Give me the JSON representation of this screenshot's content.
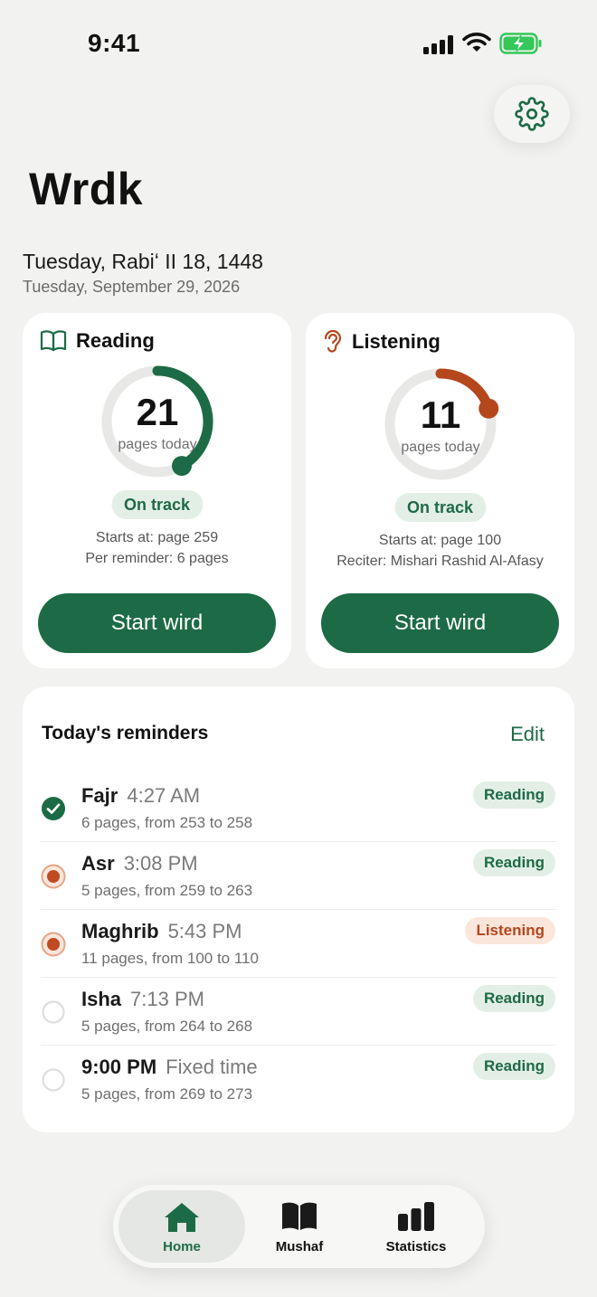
{
  "status_bar": {
    "time": "9:41"
  },
  "app": {
    "title": "Wrdk"
  },
  "dates": {
    "hijri": "Tuesday, Rabiʻ II 18, 1448",
    "gregorian": "Tuesday, September 29, 2026"
  },
  "colors": {
    "primary": "#1d6b46",
    "accent_listening": "#b4471c",
    "background": "#f2f2f0"
  },
  "reading_card": {
    "title": "Reading",
    "icon": "book-icon",
    "count": "21",
    "count_label": "pages today",
    "progress_fraction": 0.42,
    "status": "On track",
    "info_line1": "Starts at: page 259",
    "info_line2": "Per reminder: 6 pages",
    "button_label": "Start wird"
  },
  "listening_card": {
    "title": "Listening",
    "icon": "ear-icon",
    "count": "11",
    "count_label": "pages today",
    "progress_fraction": 0.2,
    "status": "On track",
    "info_line1": "Starts at: page 100",
    "info_line2": "Reciter: Mishari Rashid Al-Afasy",
    "button_label": "Start wird"
  },
  "reminders": {
    "title": "Today's reminders",
    "edit_label": "Edit",
    "items": [
      {
        "name": "Fajr",
        "time": "4:27 AM",
        "desc": "6 pages, from 253 to 258",
        "type": "Reading",
        "state": "done"
      },
      {
        "name": "Asr",
        "time": "3:08 PM",
        "desc": "5 pages, from 259 to 263",
        "type": "Reading",
        "state": "active"
      },
      {
        "name": "Maghrib",
        "time": "5:43 PM",
        "desc": "11 pages, from 100 to 110",
        "type": "Listening",
        "state": "active"
      },
      {
        "name": "Isha",
        "time": "7:13 PM",
        "desc": "5 pages, from 264 to 268",
        "type": "Reading",
        "state": "pending"
      },
      {
        "name": "9:00 PM",
        "time": "Fixed time",
        "desc": "5 pages, from 269 to 273",
        "type": "Reading",
        "state": "pending"
      }
    ]
  },
  "tabbar": {
    "items": [
      {
        "label": "Home",
        "icon": "home-icon",
        "active": true
      },
      {
        "label": "Mushaf",
        "icon": "book-open-icon",
        "active": false
      },
      {
        "label": "Statistics",
        "icon": "bar-chart-icon",
        "active": false
      }
    ]
  }
}
